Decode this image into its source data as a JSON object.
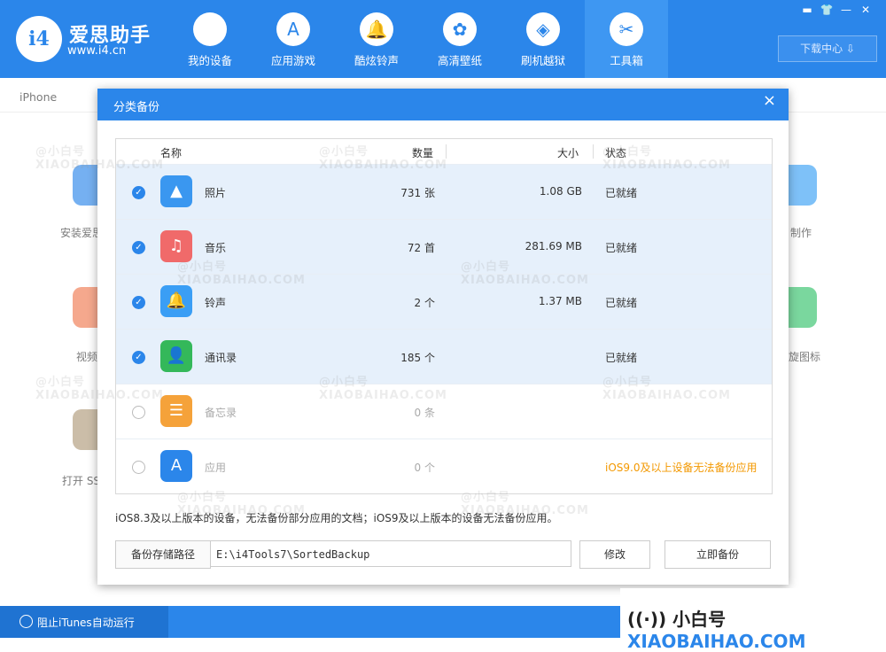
{
  "header": {
    "brand_name": "爱思助手",
    "brand_url": "www.i4.cn",
    "logo_text": "i4",
    "nav": [
      {
        "label": "我的设备",
        "icon": "apple-icon",
        "glyph": ""
      },
      {
        "label": "应用游戏",
        "icon": "appstore-icon",
        "glyph": "A"
      },
      {
        "label": "酷炫铃声",
        "icon": "bell-icon",
        "glyph": "🔔"
      },
      {
        "label": "高清壁纸",
        "icon": "flower-icon",
        "glyph": "✿"
      },
      {
        "label": "刷机越狱",
        "icon": "box-icon",
        "glyph": "◈"
      },
      {
        "label": "工具箱",
        "icon": "tools-icon",
        "glyph": "✂"
      }
    ],
    "download_center": "下载中心 ⇩",
    "window_buttons": [
      "▬",
      "👕",
      "—",
      "✕"
    ]
  },
  "device_tab": "iPhone",
  "background_tools": {
    "left": [
      "安装爱思",
      "视频",
      "打开 SS"
    ],
    "right": [
      "制作",
      "旋图标"
    ]
  },
  "footer": {
    "itunes_toggle": "阻止iTunes自动运行",
    "watermark_prefix": "((·)) 小白号",
    "watermark_domain": "XIAOBAIHAO.COM"
  },
  "dialog": {
    "title": "分类备份",
    "close": "×",
    "columns": {
      "name": "名称",
      "qty": "数量",
      "size": "大小",
      "status": "状态"
    },
    "rows": [
      {
        "checked": true,
        "name": "照片",
        "qty": "731 张",
        "size": "1.08 GB",
        "status": "已就绪",
        "icon": "photos-icon",
        "glyph": "▲",
        "color": "#3a97f0"
      },
      {
        "checked": true,
        "name": "音乐",
        "qty": "72 首",
        "size": "281.69 MB",
        "status": "已就绪",
        "icon": "music-icon",
        "glyph": "♫",
        "color": "#f06a6a"
      },
      {
        "checked": true,
        "name": "铃声",
        "qty": "2 个",
        "size": "1.37 MB",
        "status": "已就绪",
        "icon": "bell-icon",
        "glyph": "🔔",
        "color": "#3a9ef5"
      },
      {
        "checked": true,
        "name": "通讯录",
        "qty": "185 个",
        "size": "",
        "status": "已就绪",
        "icon": "contacts-icon",
        "glyph": "👤",
        "color": "#34b85a"
      },
      {
        "checked": false,
        "name": "备忘录",
        "qty": "0 条",
        "size": "",
        "status": "",
        "icon": "notes-icon",
        "glyph": "☰",
        "color": "#f5a23a"
      },
      {
        "checked": false,
        "name": "应用",
        "qty": "0 个",
        "size": "",
        "status": "iOS9.0及以上设备无法备份应用",
        "icon": "appstore-icon",
        "glyph": "A",
        "color": "#2b86ea"
      }
    ],
    "note": "iOS8.3及以上版本的设备，无法备份部分应用的文档；iOS9及以上版本的设备无法备份应用。",
    "path_label": "备份存储路径",
    "path_value": "E:\\i4Tools7\\SortedBackup",
    "modify_button": "修改",
    "backup_button": "立即备份"
  },
  "watermark": {
    "line1": "@小白号",
    "line2": "XIAOBAIHAO.COM"
  }
}
